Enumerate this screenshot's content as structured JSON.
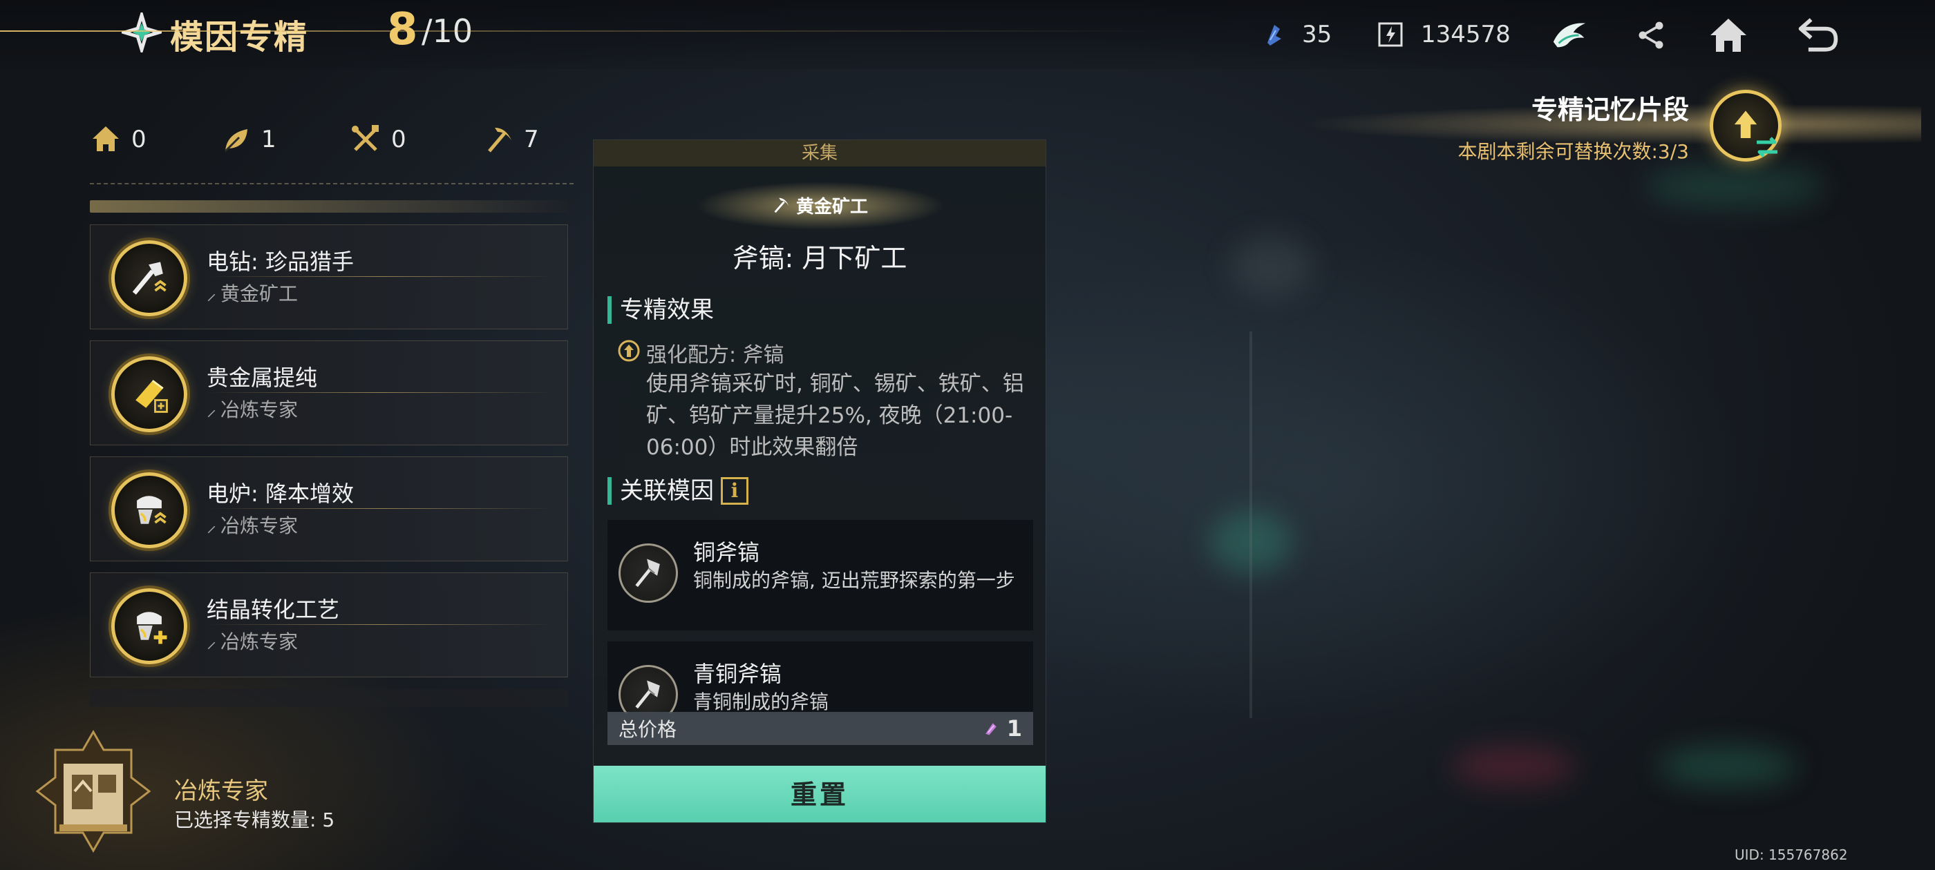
{
  "header": {
    "title": "模因专精",
    "count_current": "8",
    "count_max": "/10",
    "resource1_value": "35",
    "resource2_value": "134578",
    "icons": [
      "meme-logo-icon",
      "crystal-icon",
      "energy-cube-icon",
      "faction-logo-icon",
      "share-icon",
      "home-icon",
      "back-icon"
    ]
  },
  "stats": {
    "home": "0",
    "leaf": "1",
    "tools": "0",
    "pickaxe": "7"
  },
  "spec_list": [
    {
      "name": "电钻: 珍品猎手",
      "tag": "黄金矿工"
    },
    {
      "name": "贵金属提纯",
      "tag": "冶炼专家"
    },
    {
      "name": "电炉: 降本增效",
      "tag": "冶炼专家"
    },
    {
      "name": "结晶转化工艺",
      "tag": "冶炼专家"
    }
  ],
  "profile": {
    "name": "冶炼专家",
    "selected_count": "已选择专精数量: 5"
  },
  "detail": {
    "category": "采集",
    "sub_badge": "黄金矿工",
    "title": "斧镐: 月下矿工",
    "effect_heading": "专精效果",
    "effect_sub": "强化配方: 斧镐",
    "effect_desc": "使用斧镐采矿时, 铜矿、锡矿、铁矿、铝矿、钨矿产量提升25%, 夜晚（21:00-06:00）时此效果翻倍",
    "related_heading": "关联模因",
    "related": [
      {
        "name": "铜斧镐",
        "desc": "铜制成的斧镐, 迈出荒野探索的第一步"
      },
      {
        "name": "青铜斧镐",
        "desc": "青铜制成的斧镐"
      }
    ],
    "price_label": "总价格",
    "price_value": "1",
    "reset_label": "重置"
  },
  "memory": {
    "title": "专精记忆片段",
    "subtitle": "本剧本剩余可替换次数:3/3"
  },
  "uid": "UID: 155767862",
  "colors": {
    "gold": "#e5c25c",
    "accent_green": "#33b795",
    "button_teal": "#6fdcbf"
  }
}
